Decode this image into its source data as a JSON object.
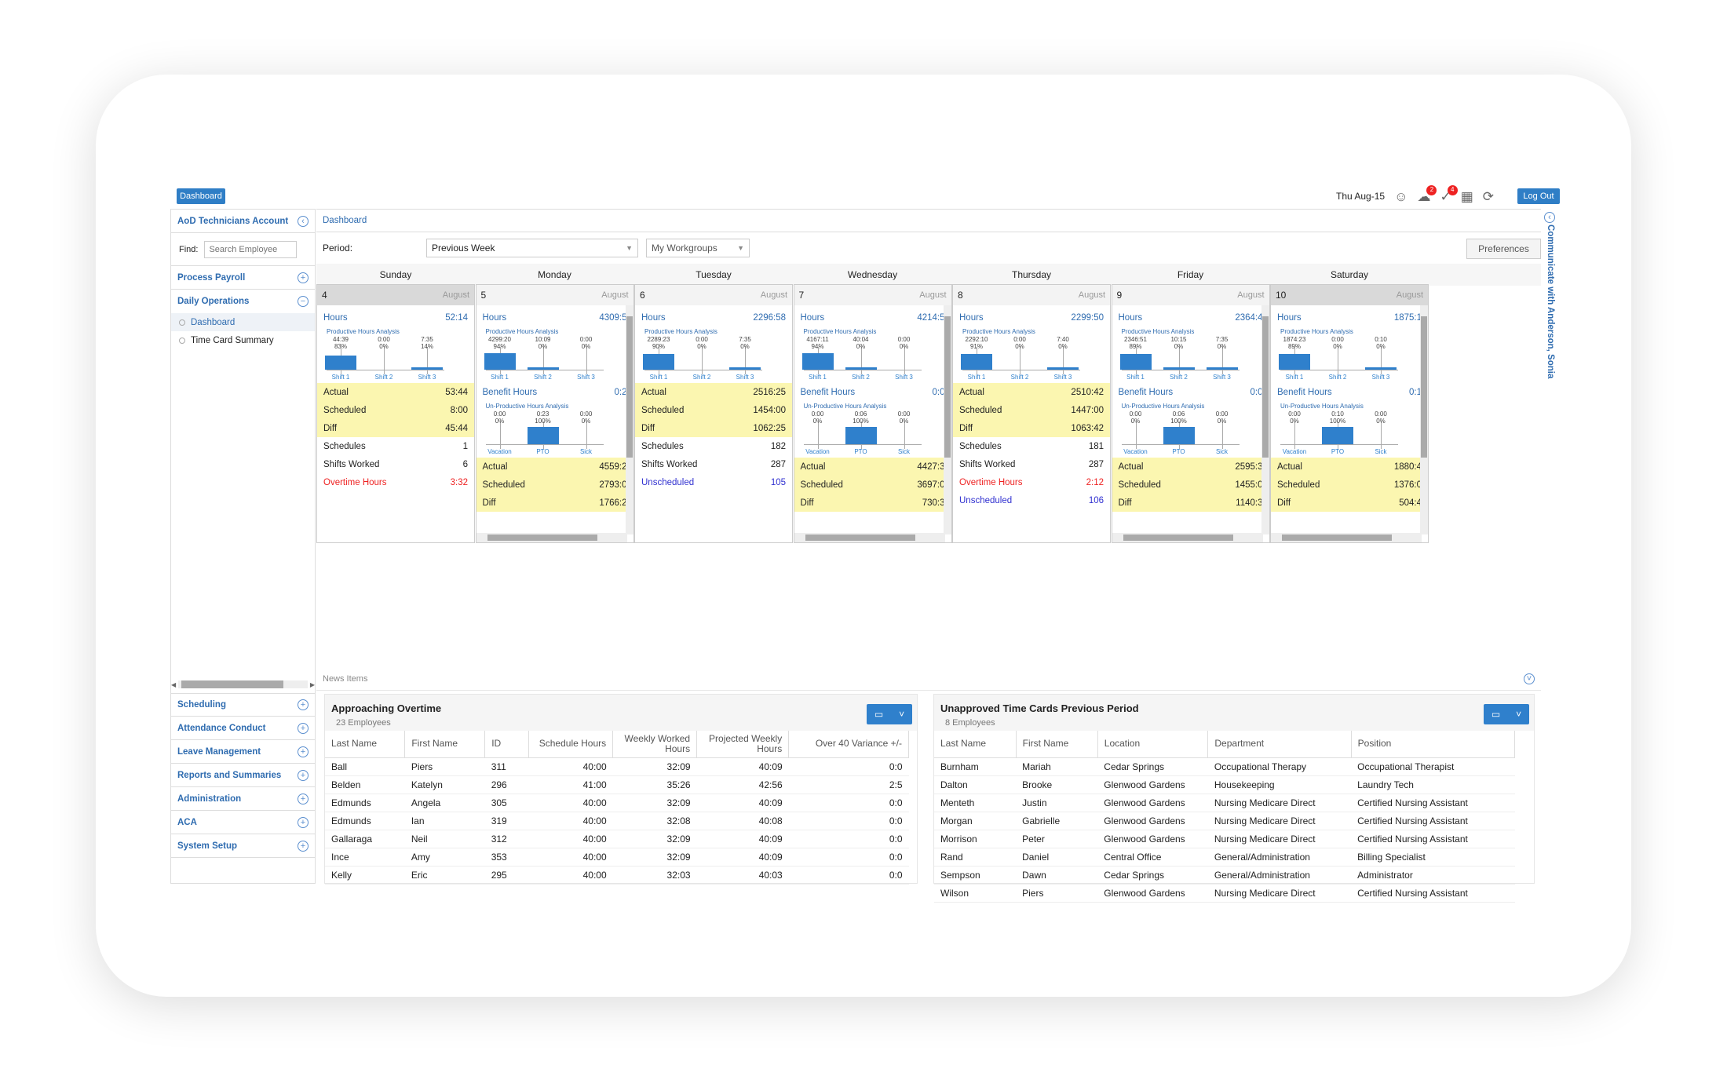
{
  "topbar": {
    "dashboard_label": "Dashboard",
    "date": "Thu Aug-15",
    "alerts_count": "2",
    "notifications_count": "4",
    "logout_label": "Log Out"
  },
  "sidebar": {
    "account": "AoD Technicians Account",
    "find_label": "Find:",
    "search_placeholder": "Search Employee",
    "process_payroll": "Process Payroll",
    "daily_operations": "Daily Operations",
    "sub": [
      "Dashboard",
      "Time Card Summary"
    ],
    "bottom": [
      "Scheduling",
      "Attendance Conduct",
      "Leave Management",
      "Reports and Summaries",
      "Administration",
      "ACA",
      "System Setup"
    ]
  },
  "main": {
    "breadcrumb": "Dashboard",
    "period_label": "Period:",
    "period_value": "Previous Week",
    "workgroups": "My Workgroups",
    "preferences": "Preferences",
    "side_tab": "Communicate with Anderson, Sonia",
    "month": "August",
    "days": [
      "Sunday",
      "Monday",
      "Tuesday",
      "Wednesday",
      "Thursday",
      "Friday",
      "Saturday"
    ]
  },
  "labels": {
    "hours": "Hours",
    "productive": "Productive Hours Analysis",
    "unproductive": "Un-Productive Hours Analysis",
    "benefit": "Benefit Hours",
    "actual": "Actual",
    "scheduled": "Scheduled",
    "diff": "Diff",
    "schedules": "Schedules",
    "shifts_worked": "Shifts Worked",
    "overtime": "Overtime Hours",
    "unscheduled": "Unscheduled",
    "shift1": "Shift 1",
    "shift2": "Shift 2",
    "shift3": "Shift 3",
    "vacation": "Vacation",
    "pto": "PTO",
    "sick": "Sick"
  },
  "cal": [
    {
      "date": "4",
      "hours": "52:14",
      "prod": [
        [
          "44:39",
          "83%"
        ],
        [
          "0:00",
          "0%"
        ],
        [
          "7:35",
          "14%"
        ]
      ],
      "prodFill": [
        0.83,
        0,
        0.14
      ],
      "actual": "53:44",
      "scheduled": "8:00",
      "diff": "45:44",
      "schedules": "1",
      "shifts": "6",
      "overtime": "3:32"
    },
    {
      "date": "5",
      "hours": "4309:5",
      "prod": [
        [
          "4299:20",
          "94%"
        ],
        [
          "10:09",
          "0%"
        ],
        [
          "0:00",
          "0%"
        ]
      ],
      "prodFill": [
        0.94,
        0.02,
        0
      ],
      "benefit": "0:2",
      "unprod": [
        [
          "0:00",
          "0%"
        ],
        [
          "0:23",
          "100%"
        ],
        [
          "0:00",
          "0%"
        ]
      ],
      "unprodFill": [
        0,
        1,
        0
      ],
      "actual": "4559:2",
      "scheduled": "2793:0",
      "diff": "1766:2"
    },
    {
      "date": "6",
      "hours": "2296:58",
      "prod": [
        [
          "2289:23",
          "90%"
        ],
        [
          "0:00",
          "0%"
        ],
        [
          "7:35",
          "0%"
        ]
      ],
      "prodFill": [
        0.9,
        0,
        0.02
      ],
      "actual": "2516:25",
      "scheduled": "1454:00",
      "diff": "1062:25",
      "schedules": "182",
      "shifts": "287",
      "unscheduled": "105"
    },
    {
      "date": "7",
      "hours": "4214:5",
      "prod": [
        [
          "4167:11",
          "94%"
        ],
        [
          "40:04",
          "0%"
        ],
        [
          "0:00",
          "0%"
        ]
      ],
      "prodFill": [
        0.94,
        0.03,
        0
      ],
      "benefit": "0:0",
      "unprod": [
        [
          "0:00",
          "0%"
        ],
        [
          "0:06",
          "100%"
        ],
        [
          "0:00",
          "0%"
        ]
      ],
      "unprodFill": [
        0,
        1,
        0
      ],
      "actual": "4427:3",
      "scheduled": "3697:0",
      "diff": "730:3"
    },
    {
      "date": "8",
      "hours": "2299:50",
      "prod": [
        [
          "2292:10",
          "91%"
        ],
        [
          "0:00",
          "0%"
        ],
        [
          "7:40",
          "0%"
        ]
      ],
      "prodFill": [
        0.91,
        0,
        0.02
      ],
      "actual": "2510:42",
      "scheduled": "1447:00",
      "diff": "1063:42",
      "schedules": "181",
      "shifts": "287",
      "overtime": "2:12",
      "unscheduled": "106"
    },
    {
      "date": "9",
      "hours": "2364:4",
      "prod": [
        [
          "2346:51",
          "89%"
        ],
        [
          "10:15",
          "0%"
        ],
        [
          "7:35",
          "0%"
        ]
      ],
      "prodFill": [
        0.89,
        0.02,
        0.02
      ],
      "benefit": "0:0",
      "unprod": [
        [
          "0:00",
          "0%"
        ],
        [
          "0:06",
          "100%"
        ],
        [
          "0:00",
          "0%"
        ]
      ],
      "unprodFill": [
        0,
        1,
        0
      ],
      "actual": "2595:3",
      "scheduled": "1455:0",
      "diff": "1140:3"
    },
    {
      "date": "10",
      "hours": "1875:1",
      "prod": [
        [
          "1874:23",
          "89%"
        ],
        [
          "0:00",
          "0%"
        ],
        [
          "0:10",
          "0%"
        ]
      ],
      "prodFill": [
        0.89,
        0,
        0.01
      ],
      "benefit": "0:1",
      "unprod": [
        [
          "0:00",
          "0%"
        ],
        [
          "0:10",
          "100%"
        ],
        [
          "0:00",
          "0%"
        ]
      ],
      "unprodFill": [
        0,
        1,
        0
      ],
      "actual": "1880:4",
      "scheduled": "1376:0",
      "diff": "504:4"
    }
  ],
  "news": {
    "title": "News Items",
    "overtime": {
      "title": "Approaching Overtime",
      "count": "23 Employees",
      "headers": [
        "Last Name",
        "First Name",
        "ID",
        "Schedule Hours",
        "Weekly Worked Hours",
        "Projected Weekly Hours",
        "Over 40 Variance +/-"
      ],
      "rows": [
        [
          "Ball",
          "Piers",
          "311",
          "40:00",
          "32:09",
          "40:09",
          "0:0"
        ],
        [
          "Belden",
          "Katelyn",
          "296",
          "41:00",
          "35:26",
          "42:56",
          "2:5"
        ],
        [
          "Edmunds",
          "Angela",
          "305",
          "40:00",
          "32:09",
          "40:09",
          "0:0"
        ],
        [
          "Edmunds",
          "Ian",
          "319",
          "40:00",
          "32:08",
          "40:08",
          "0:0"
        ],
        [
          "Gallaraga",
          "Neil",
          "312",
          "40:00",
          "32:09",
          "40:09",
          "0:0"
        ],
        [
          "Ince",
          "Amy",
          "353",
          "40:00",
          "32:09",
          "40:09",
          "0:0"
        ],
        [
          "Kelly",
          "Eric",
          "295",
          "40:00",
          "32:03",
          "40:03",
          "0:0"
        ]
      ]
    },
    "unapproved": {
      "title": "Unapproved Time Cards Previous Period",
      "count": "8 Employees",
      "headers": [
        "Last Name",
        "First Name",
        "Location",
        "Department",
        "Position"
      ],
      "rows": [
        [
          "Burnham",
          "Mariah",
          "Cedar Springs",
          "Occupational Therapy",
          "Occupational Therapist"
        ],
        [
          "Dalton",
          "Brooke",
          "Glenwood Gardens",
          "Housekeeping",
          "Laundry Tech"
        ],
        [
          "Menteth",
          "Justin",
          "Glenwood Gardens",
          "Nursing Medicare Direct",
          "Certified Nursing Assistant"
        ],
        [
          "Morgan",
          "Gabrielle",
          "Glenwood Gardens",
          "Nursing Medicare Direct",
          "Certified Nursing Assistant"
        ],
        [
          "Morrison",
          "Peter",
          "Glenwood Gardens",
          "Nursing Medicare Direct",
          "Certified Nursing Assistant"
        ],
        [
          "Rand",
          "Daniel",
          "Central Office",
          "General/Administration",
          "Billing Specialist"
        ],
        [
          "Sempson",
          "Dawn",
          "Cedar Springs",
          "General/Administration",
          "Administrator"
        ],
        [
          "Wilson",
          "Piers",
          "Glenwood Gardens",
          "Nursing Medicare Direct",
          "Certified Nursing Assistant"
        ]
      ]
    }
  }
}
